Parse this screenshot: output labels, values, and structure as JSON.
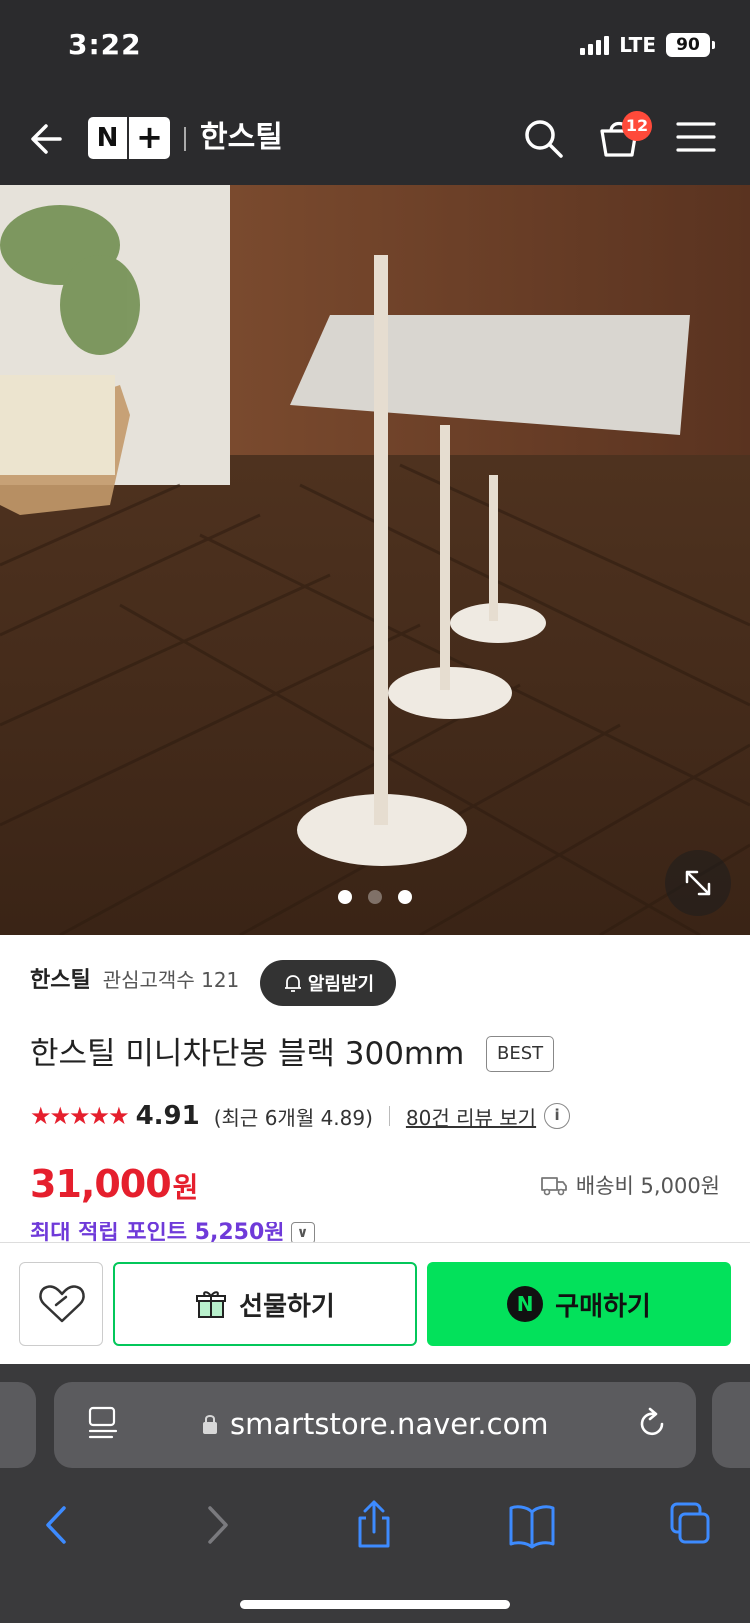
{
  "status": {
    "time": "3:22",
    "network": "LTE",
    "battery": "90"
  },
  "header": {
    "logo_n": "N",
    "logo_plus": "+",
    "store_name": "한스틸",
    "cart_count": "12"
  },
  "gallery": {
    "total_images": 3,
    "active_index": 2
  },
  "seller": {
    "name": "한스틸",
    "fans_label": "관심고객수 121",
    "alarm_label": "알림받기"
  },
  "product": {
    "title": "한스틸 미니차단봉 블랙 300mm",
    "badge": "BEST",
    "stars": "★★★★★",
    "rating": "4.91",
    "recent_rating": "(최근 6개월 4.89)",
    "review_link": "80건 리뷰 보기",
    "info_icon": "i",
    "price": "31,000",
    "price_unit": "원",
    "shipping": "배송비 5,000원",
    "points": "최대 적립 포인트 5,250원"
  },
  "actions": {
    "gift_label": "선물하기",
    "buy_label": "구매하기",
    "buy_icon_text": "N"
  },
  "browser": {
    "url": "smartstore.naver.com"
  },
  "colors": {
    "accent_red": "#e51f2d",
    "naver_green": "#03e15b",
    "points_purple": "#6f3ad9",
    "header_dark": "#2b2b2d"
  }
}
